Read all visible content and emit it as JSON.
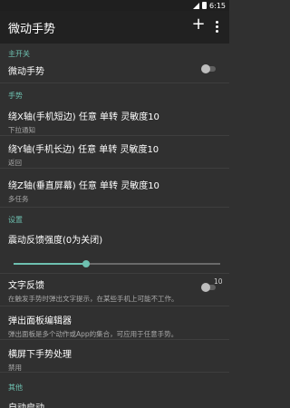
{
  "status_bar": {
    "time": "6:15"
  },
  "app_bar": {
    "title": "微动手势",
    "add_icon": "+",
    "menu_icon": "more-vert"
  },
  "sections": {
    "main_switch": "主开关",
    "gestures": "手势",
    "settings": "设置",
    "other": "其他"
  },
  "items": {
    "micro_gesture": {
      "title": "微动手势",
      "enabled": false
    },
    "x_axis": {
      "title": "绕X轴(手机短边) 任意 单转 灵敏度10",
      "summary": "下拉通知"
    },
    "y_axis": {
      "title": "绕Y轴(手机长边) 任意 单转 灵敏度10",
      "summary": "返回"
    },
    "z_axis": {
      "title": "绕Z轴(垂直屏幕) 任意 单转 灵敏度10",
      "summary": "多任务"
    },
    "vibration": {
      "title": "震动反馈强度(0为关闭)",
      "value_label": "10",
      "level_fraction": 0.35
    },
    "text_feedback": {
      "title": "文字反馈",
      "summary": "在触发手势时弹出文字提示，在某些手机上可能不工作。",
      "enabled": false
    },
    "panel_editor": {
      "title": "弹出面板编辑器",
      "summary": "弹出面板是多个动作或App的集合，可应用于任意手势。"
    },
    "landscape": {
      "title": "横屏下手势处理",
      "summary": "禁用"
    },
    "autostart": {
      "title": "自动启动"
    }
  },
  "colors": {
    "accent": "#6ec0b0",
    "background": "#303030",
    "app_bar": "#212121"
  }
}
